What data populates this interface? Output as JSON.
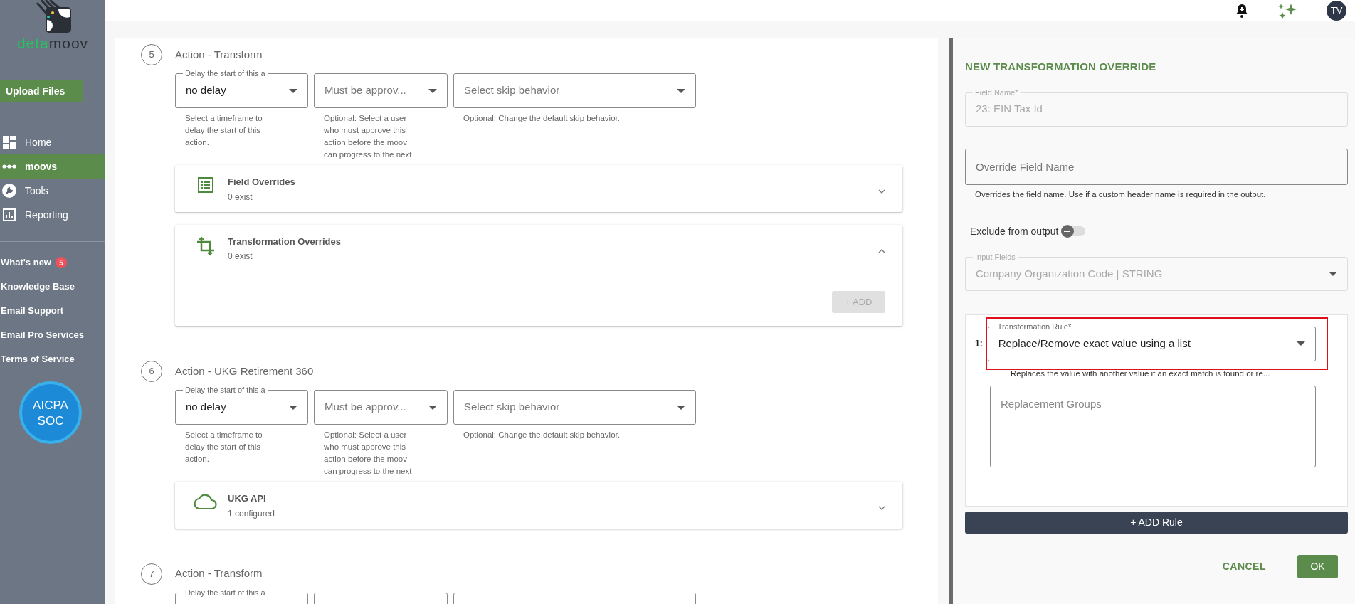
{
  "sidebar": {
    "logo_text_1": "deta",
    "logo_text_2": "moov",
    "upload_button": "Upload Files",
    "nav": [
      {
        "label": "Home",
        "kind": "dashboard",
        "selected": false
      },
      {
        "label": "moovs",
        "kind": "dots",
        "selected": true
      },
      {
        "label": "Tools",
        "kind": "wrench",
        "selected": false
      },
      {
        "label": "Reporting",
        "kind": "chart",
        "selected": false
      }
    ],
    "links": [
      {
        "label": "What's new",
        "badge": "5"
      },
      {
        "label": "Knowledge Base"
      },
      {
        "label": "Email Support"
      },
      {
        "label": "Email Pro Services"
      },
      {
        "label": "Terms of Service"
      }
    ],
    "certification": {
      "line_1": "AICPA",
      "line_2": "SOC"
    }
  },
  "topbar": {
    "avatar_initials": "TV"
  },
  "steps": [
    {
      "number": "5",
      "title": "Action - Transform",
      "selects": [
        {
          "label": "Delay the start of this a",
          "value": "no delay",
          "helper": "Select a timeframe to delay the start of this action."
        },
        {
          "placeholder": "Must be approv...",
          "helper": "Optional: Select a user who must approve this action before the moov can progress to the next"
        },
        {
          "placeholder": "Select skip behavior",
          "helper": "Optional: Change the default skip behavior."
        }
      ],
      "panels": [
        {
          "kind": "list",
          "title": "Field Overrides",
          "subtitle": "0 exist",
          "expanded": false
        },
        {
          "kind": "crop",
          "title": "Transformation Overrides",
          "subtitle": "0 exist",
          "expanded": true,
          "button": "+ ADD"
        }
      ]
    },
    {
      "number": "6",
      "title": "Action - UKG Retirement 360",
      "selects": [
        {
          "label": "Delay the start of this a",
          "value": "no delay",
          "helper": "Select a timeframe to delay the start of this action."
        },
        {
          "placeholder": "Must be approv...",
          "helper": "Optional: Select a user who must approve this action before the moov can progress to the next"
        },
        {
          "placeholder": "Select skip behavior",
          "helper": "Optional: Change the default skip behavior."
        }
      ],
      "panels": [
        {
          "kind": "cloud",
          "title": "UKG API",
          "subtitle": "1 configured",
          "expanded": false
        }
      ]
    },
    {
      "number": "7",
      "title": "Action - Transform",
      "selects": [
        {
          "label": "Delay the start of this a"
        }
      ]
    }
  ],
  "override": {
    "title": "NEW TRANSFORMATION OVERRIDE",
    "field_name": {
      "label": "Field Name*",
      "value": "23: EIN Tax Id",
      "disabled": true
    },
    "override_field": {
      "placeholder": "Override Field Name",
      "helper": "Overrides the field name. Use if a custom header name is required in the output."
    },
    "exclude": {
      "label": "Exclude from output",
      "on": false
    },
    "input_fields": {
      "label": "Input Fields",
      "value": "Company Organization Code | STRING",
      "disabled": true
    },
    "rules": [
      {
        "index": "1:",
        "label": "Transformation Rule*",
        "value": "Replace/Remove exact value using a list",
        "helper": "Replaces the value with another value if an exact match is found or re...",
        "highlighted": true,
        "textarea_placeholder": "Replacement Groups"
      }
    ],
    "add_rule": "+ ADD Rule",
    "cancel": "CANCEL",
    "ok": "OK"
  }
}
